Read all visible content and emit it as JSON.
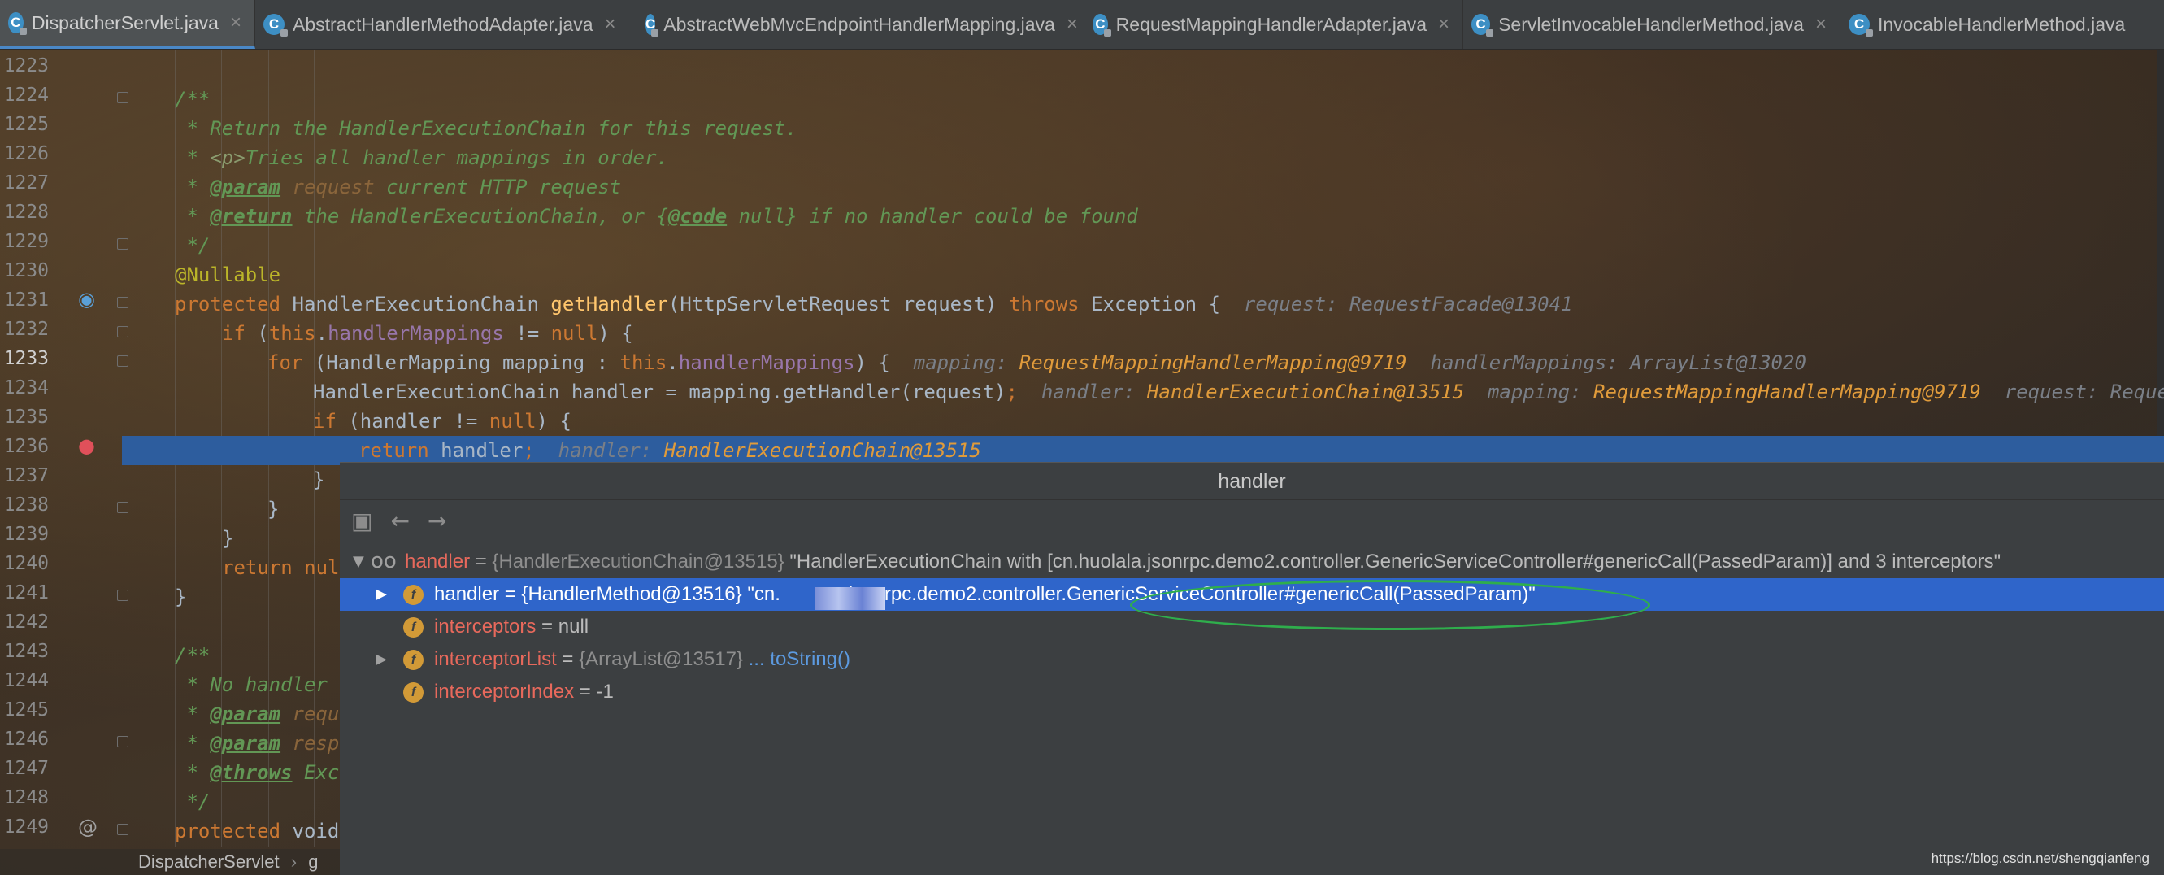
{
  "tabs": [
    {
      "label": "DispatcherServlet.java",
      "active": true,
      "closable": true
    },
    {
      "label": "AbstractHandlerMethodAdapter.java",
      "active": false,
      "closable": true
    },
    {
      "label": "AbstractWebMvcEndpointHandlerMapping.java",
      "active": false,
      "closable": true
    },
    {
      "label": "RequestMappingHandlerAdapter.java",
      "active": false,
      "closable": true
    },
    {
      "label": "ServletInvocableHandlerMethod.java",
      "active": false,
      "closable": true
    },
    {
      "label": "InvocableHandlerMethod.java",
      "active": false,
      "closable": false
    }
  ],
  "tab_icon_letter": "C",
  "tab_close_glyph": "×",
  "line_numbers": [
    "1223",
    "1224",
    "1225",
    "1226",
    "1227",
    "1228",
    "1229",
    "1230",
    "1231",
    "1232",
    "1233",
    "1234",
    "1235",
    "1236",
    "1237",
    "1238",
    "1239",
    "1240",
    "1241",
    "1242",
    "1243",
    "1244",
    "1245",
    "1246",
    "1247",
    "1248",
    "1249"
  ],
  "current_line": "1233",
  "breakpoint_line": "1236",
  "code": {
    "l1224": "/**",
    "l1225": " * Return the HandlerExecutionChain for this request.",
    "l1226a": " * ",
    "l1226b": "<p>",
    "l1226c": "Tries all handler mappings in order.",
    "l1227a": " * ",
    "l1227b": "@param",
    "l1227c": " request",
    "l1227d": " current HTTP request",
    "l1228a": " * ",
    "l1228b": "@return",
    "l1228c": " the HandlerExecutionChain, or {",
    "l1228d": "@code",
    "l1228e": " null} if no handler could be found",
    "l1229": " */",
    "l1230": "@Nullable",
    "l1231_kw": "protected",
    "l1231_type": " HandlerExecutionChain ",
    "l1231_fn": "getHandler",
    "l1231_args": "(HttpServletRequest request) ",
    "l1231_throws": "throws",
    "l1231_rest": " Exception {  ",
    "l1231_hint": "request: RequestFacade@13041",
    "l1232_kw": "if",
    "l1232_a": " (",
    "l1232_this": "this",
    "l1232_b": ".",
    "l1232_fld": "handlerMappings",
    "l1232_c": " != ",
    "l1232_null": "null",
    "l1232_d": ") {",
    "l1233_kw": "for",
    "l1233_a": " (HandlerMapping mapping : ",
    "l1233_this": "this",
    "l1233_b": ".",
    "l1233_fld": "handlerMappings",
    "l1233_c": ") {  ",
    "l1233_h1": "mapping: ",
    "l1233_v1": "RequestMappingHandlerMapping@9719",
    "l1233_h2": "  handlerMappings: ArrayList@13020",
    "l1234_a": "HandlerExecutionChain handler = mapping.getHandler(request)",
    "l1234_semi": ";",
    "l1234_h1": "  handler: ",
    "l1234_v1": "HandlerExecutionChain@13515",
    "l1234_h2": "  mapping: ",
    "l1234_v2": "RequestMappingHandlerMapping@9719",
    "l1234_h3": "  request: RequestFa",
    "l1235_kw": "if",
    "l1235_a": " (handler != ",
    "l1235_null": "null",
    "l1235_b": ") {",
    "l1236_kw": "return",
    "l1236_a": " handler",
    "l1236_semi": ";",
    "l1236_h1": "  handler: ",
    "l1236_v1": "HandlerExecutionChain@13515",
    "l1237": "}",
    "l1238": "}",
    "l1239": "}",
    "l1240_kw": "return",
    "l1240_a": " null",
    "l1241": "}",
    "l1243": "/**",
    "l1244": " * No handler f",
    "l1245a": " * ",
    "l1245b": "@param",
    "l1245c": " reque",
    "l1246a": " * ",
    "l1246b": "@param",
    "l1246c": " respo",
    "l1247a": " * ",
    "l1247b": "@throws",
    "l1247c": " Exce",
    "l1248": " */",
    "l1249_kw": "protected",
    "l1249_a": " void"
  },
  "popup": {
    "title": "handler",
    "rows": [
      {
        "name": "handler",
        "eq": " = ",
        "type": "{HandlerExecutionChain@13515}",
        "value": " \"HandlerExecutionChain with [cn.huolala.jsonrpc.demo2.controller.GenericServiceController#genericCall(PassedParam)] and 3 interceptors\""
      },
      {
        "name": "handler",
        "eq": " = ",
        "type": "{HandlerMethod@13516}",
        "value_a": " \"cn.",
        "value_b": "jsonrpc.demo2.controller.GenericServiceController#genericCall(PassedParam)\""
      },
      {
        "name": "interceptors",
        "eq": " = ",
        "value": "null"
      },
      {
        "name": "interceptorList",
        "eq": " = ",
        "type": "{ArrayList@13517}",
        "link": " ... toString()"
      },
      {
        "name": "interceptorIndex",
        "eq": " = ",
        "value": "-1"
      }
    ],
    "field_icon_letter": "f",
    "watch_icon": "oo"
  },
  "breadcrumb": {
    "class_name": "DispatcherServlet",
    "separator": "›",
    "next": "g"
  },
  "watermark": "https://blog.csdn.net/shengqianfeng",
  "colors": {
    "accent": "#2f65ca",
    "exec_line": "#2d5d9e",
    "keyword": "#cc7832",
    "comment": "#629755",
    "annotation_circle": "#2fae4c"
  }
}
